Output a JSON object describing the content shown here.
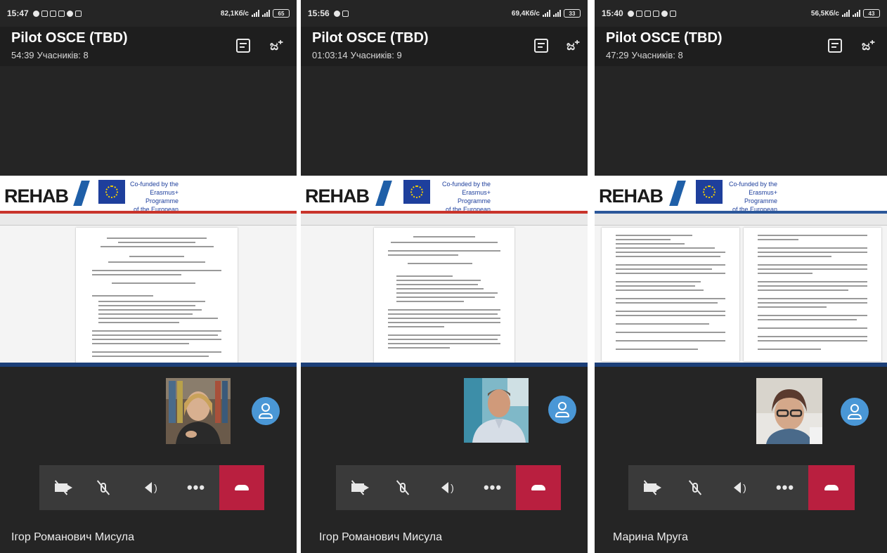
{
  "panels": [
    {
      "status": {
        "time": "15:47",
        "speed": "82,1Кб/с",
        "battery": "65"
      },
      "meeting": {
        "title": "Pilot OSCE (TBD)",
        "duration": "54:39",
        "participants": "Учасників: 8"
      },
      "banner": {
        "logo": "REHAB",
        "cofund": [
          "Co-funded by the",
          "Erasmus+ Programme",
          "of the European Union"
        ]
      },
      "speaker_name": "Ігор Романович Мисула"
    },
    {
      "status": {
        "time": "15:56",
        "speed": "69,4Кб/с",
        "battery": "33"
      },
      "meeting": {
        "title": "Pilot OSCE (TBD)",
        "duration": "01:03:14",
        "participants": "Учасників: 9"
      },
      "banner": {
        "logo": "REHAB",
        "cofund": [
          "Co-funded by the",
          "Erasmus+ Programme",
          "of the European Union"
        ]
      },
      "speaker_name": "Ігор Романович Мисула"
    },
    {
      "status": {
        "time": "15:40",
        "speed": "56,5Кб/с",
        "battery": "43"
      },
      "meeting": {
        "title": "Pilot OSCE (TBD)",
        "duration": "47:29",
        "participants": "Учасників: 8"
      },
      "banner": {
        "logo": "REHAB",
        "cofund": [
          "Co-funded by the",
          "Erasmus+ Programme",
          "of the European Union"
        ]
      },
      "speaker_name": "Марина Мруга"
    }
  ],
  "icons": {
    "chat": "chat-icon",
    "add_people": "add-people-icon",
    "camera_off": "camera-off-icon",
    "mic_off": "mic-off-icon",
    "speaker": "speaker-icon",
    "more": "more-icon",
    "hangup": "hangup-icon",
    "avatar": "avatar-icon"
  },
  "controls": {
    "more_glyph": "•••",
    "add_glyph": "ಜ⁺"
  },
  "colors": {
    "background": "#252525",
    "hangup": "#b91f3f",
    "avatar": "#4a97d6",
    "ribbon_red": "#c9342b",
    "ribbon_blue": "#2b579a"
  }
}
